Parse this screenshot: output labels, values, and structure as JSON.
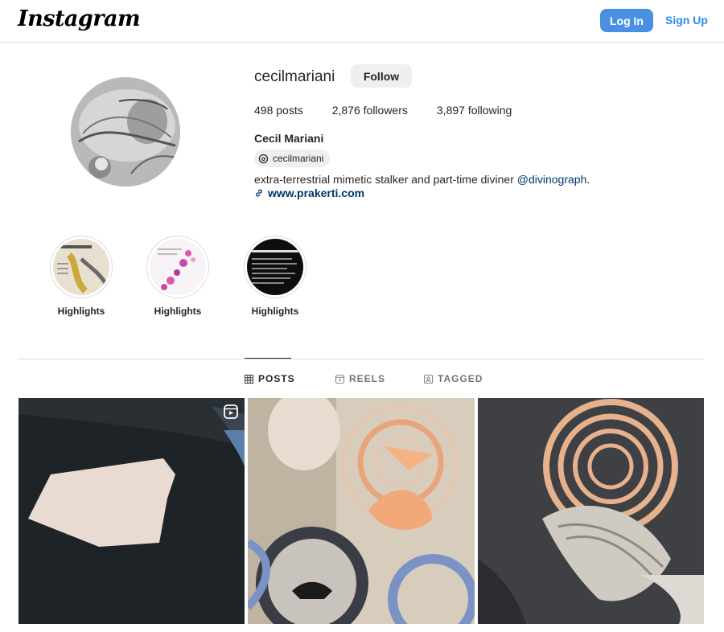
{
  "header": {
    "logo": "Instagram",
    "login_label": "Log In",
    "signup_label": "Sign Up"
  },
  "profile": {
    "username": "cecilmariani",
    "follow_label": "Follow",
    "posts": "498 posts",
    "followers": "2,876 followers",
    "following": "3,897 following",
    "full_name": "Cecil Mariani",
    "threads_handle": "cecilmariani",
    "bio_text": "extra-terrestrial mimetic stalker and part-time diviner ",
    "bio_mention": "@divinograph",
    "bio_end": ".",
    "website": "www.prakerti.com"
  },
  "highlights": [
    {
      "label": "Highlights"
    },
    {
      "label": "Highlights"
    },
    {
      "label": "Highlights"
    }
  ],
  "tabs": [
    {
      "label": "POSTS",
      "icon": "grid-icon",
      "active": true
    },
    {
      "label": "REELS",
      "icon": "reels-icon",
      "active": false
    },
    {
      "label": "TAGGED",
      "icon": "tagged-icon",
      "active": false
    }
  ],
  "colors": {
    "accent": "#4a90e2",
    "link": "#00376b",
    "text": "#262626",
    "muted": "#737373"
  }
}
